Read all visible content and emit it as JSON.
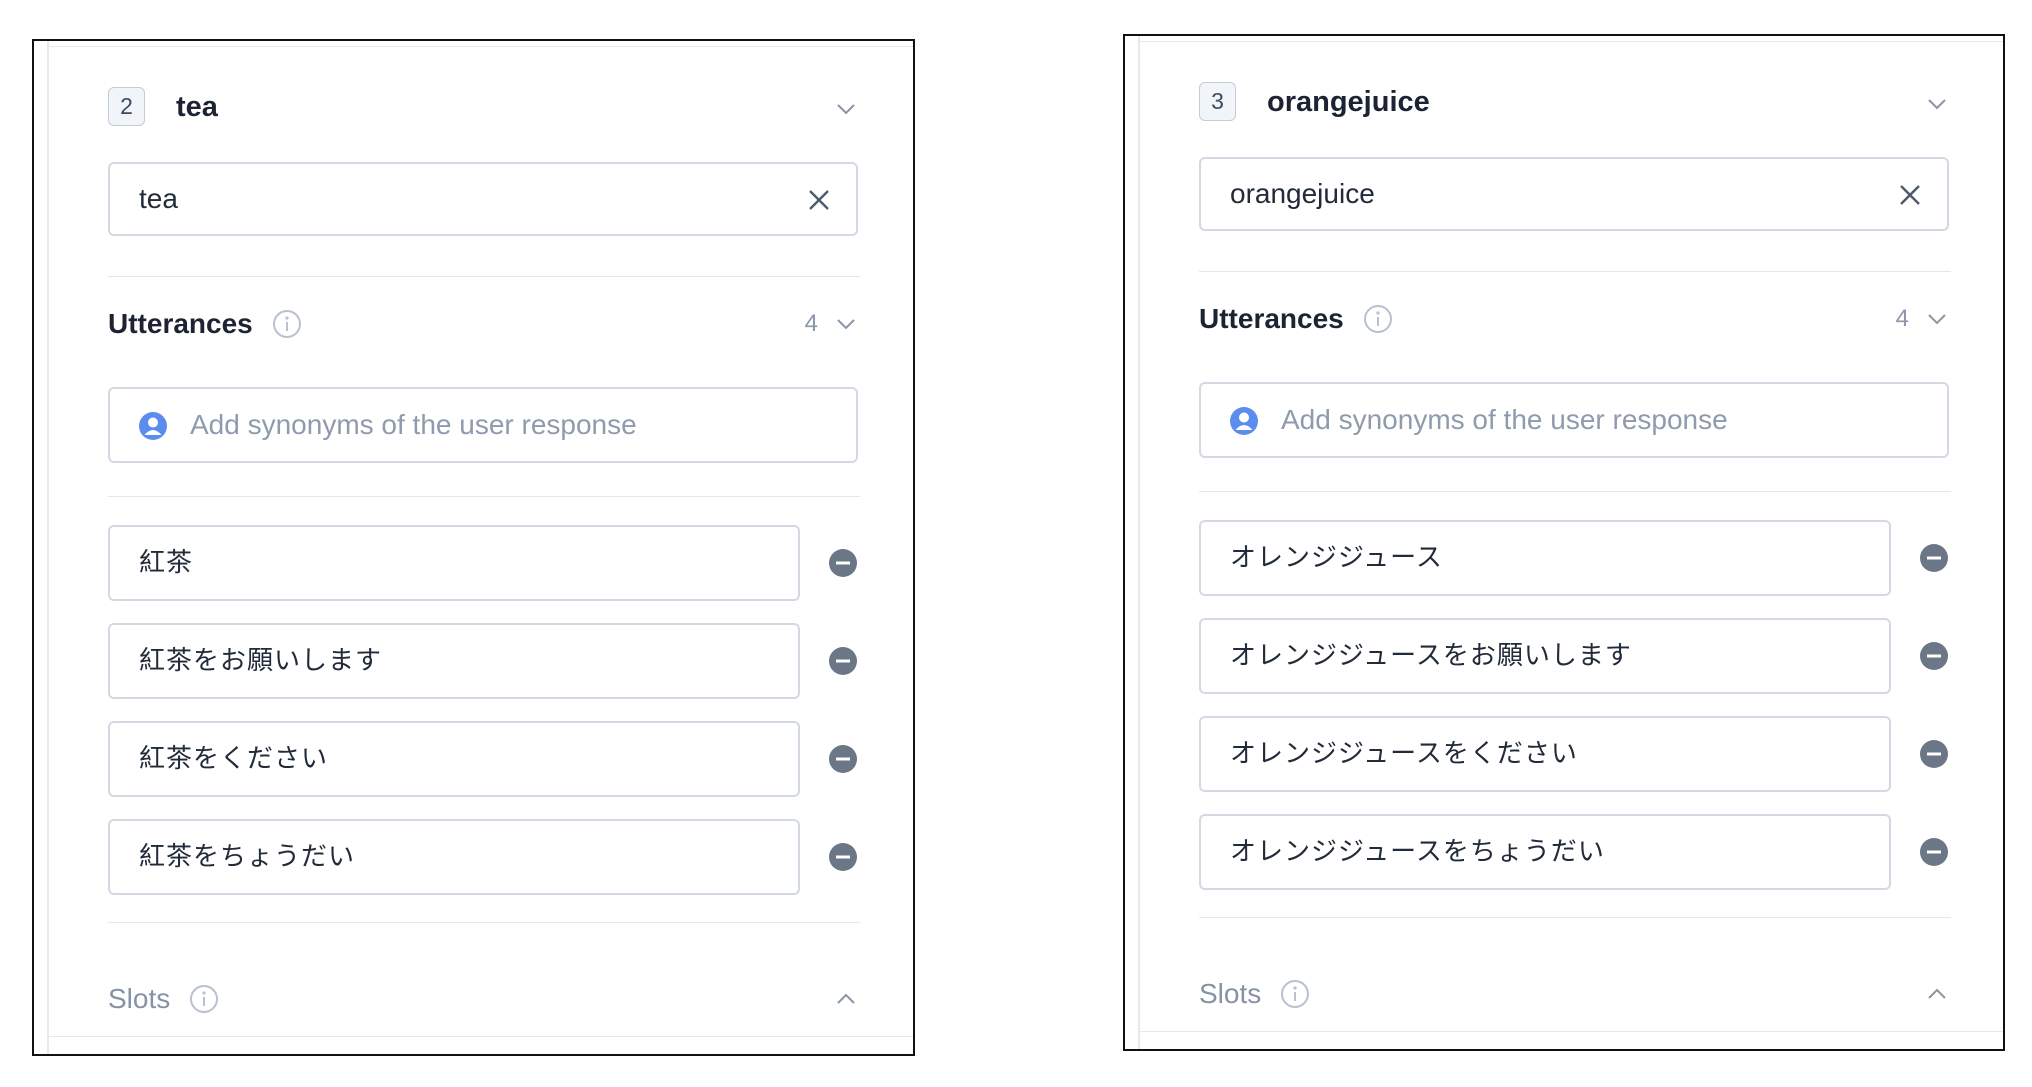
{
  "panels": [
    {
      "number": "2",
      "title": "tea",
      "value": "tea",
      "utterances_label": "Utterances",
      "utterances_count": "4",
      "add_placeholder": "Add synonyms of the user response",
      "utterances": [
        "紅茶",
        "紅茶をお願いします",
        "紅茶をください",
        "紅茶をちょうだい"
      ],
      "slots_label": "Slots"
    },
    {
      "number": "3",
      "title": "orangejuice",
      "value": "orangejuice",
      "utterances_label": "Utterances",
      "utterances_count": "4",
      "add_placeholder": "Add synonyms of the user response",
      "utterances": [
        "オレンジジュース",
        "オレンジジュースをお願いします",
        "オレンジジュースをください",
        "オレンジジュースをちょうだい"
      ],
      "slots_label": "Slots"
    }
  ],
  "icons": {
    "chevron": "chevron-down-icon",
    "clear": "close-icon",
    "info": "info-icon",
    "user": "user-icon",
    "remove": "minus-circle-icon",
    "collapse": "chevron-up-icon"
  },
  "colors": {
    "text_dark": "#1c2434",
    "muted": "#8593a6",
    "border": "#d3d9e2",
    "user_icon": "#5b8def",
    "remove_icon": "#6b7686"
  }
}
